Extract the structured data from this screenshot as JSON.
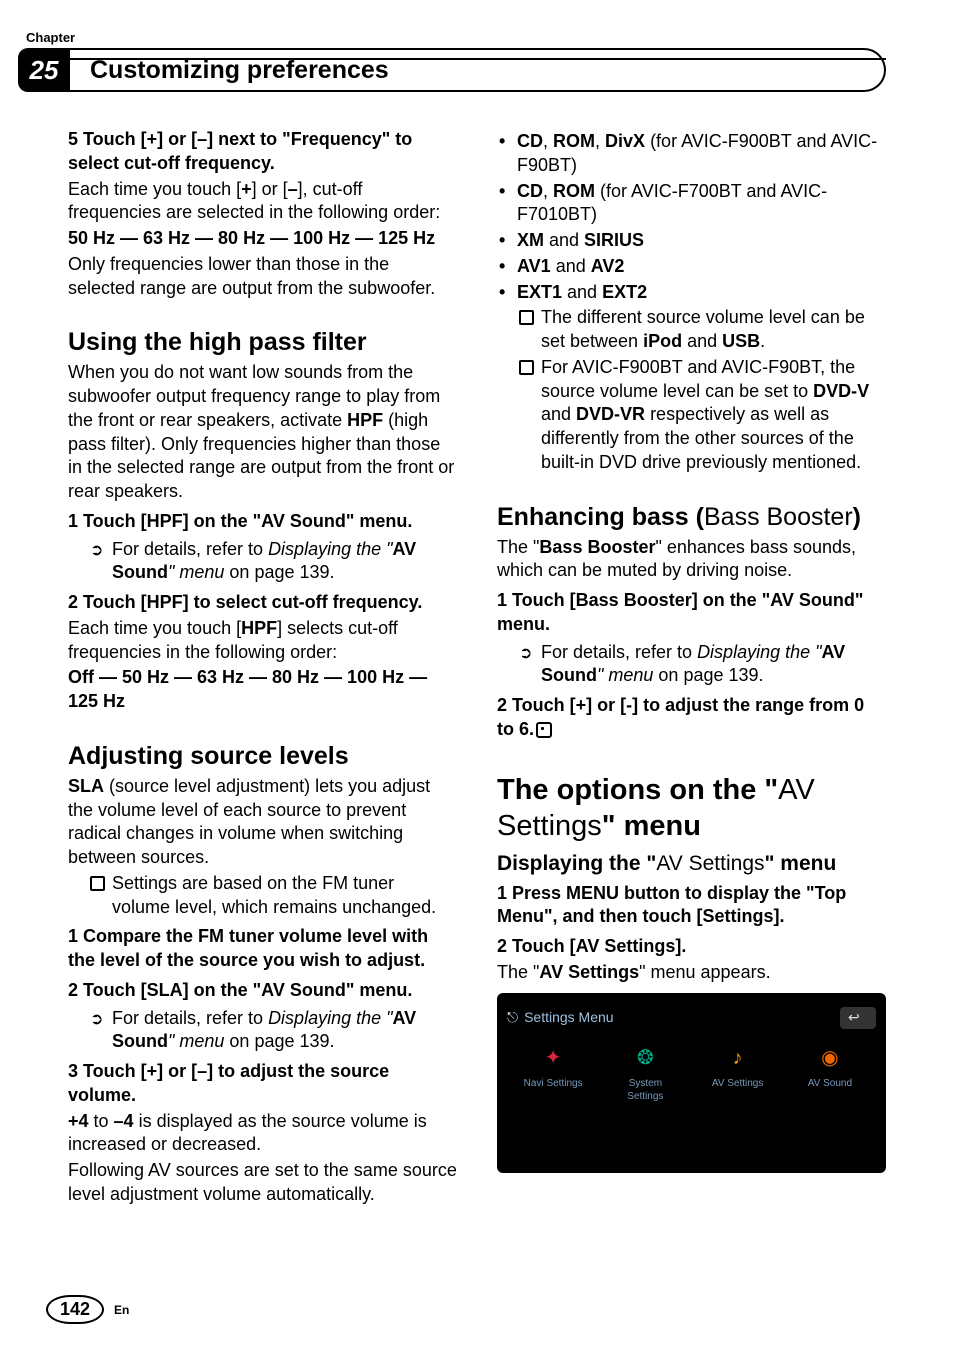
{
  "header": {
    "chapter_label": "Chapter",
    "chapter_num": "25",
    "title": "Customizing preferences"
  },
  "left": {
    "s5_head": "5    Touch [+] or [–] next to \"Frequency\" to select cut-off frequency.",
    "s5_p1_a": "Each time you touch [",
    "s5_p1_b": "+",
    "s5_p1_c": "] or [",
    "s5_p1_d": "–",
    "s5_p1_e": "], cut-off frequencies are selected in the following order:",
    "s5_freq": "50 Hz — 63 Hz — 80 Hz — 100 Hz — 125 Hz",
    "s5_p2": "Only frequencies lower than those in the selected range are output from the subwoofer.",
    "hpf_title": "Using the high pass filter",
    "hpf_p": "When you do not want low sounds from the subwoofer output frequency range to play from the front or rear speakers, activate HPF (high pass filter). Only frequencies higher than those in the selected range are output from the front or rear speakers.",
    "hpf_p_pre": "When you do not want low sounds from the subwoofer output frequency range to play from the front or rear speakers, activate ",
    "hpf_p_bold": "HPF",
    "hpf_p_post": " (high pass filter). Only frequencies higher than those in the selected range are output from the front or rear speakers.",
    "hpf_s1_head": "1    Touch [HPF] on the \"AV Sound\" menu.",
    "ref_prefix": "For details, refer to ",
    "ref_italic": "Displaying the \"",
    "ref_bold": "AV Sound",
    "ref_tail": "\" menu",
    "ref_page": " on page 139.",
    "hpf_s2_head": "2    Touch [HPF] to select cut-off frequency.",
    "hpf_s2_p_a": "Each time you touch [",
    "hpf_s2_p_b": "HPF",
    "hpf_s2_p_c": "] selects cut-off frequencies in the following order:",
    "hpf_s2_freq": "Off — 50 Hz — 63 Hz — 80 Hz — 100 Hz — 125 Hz",
    "sla_title": "Adjusting source levels",
    "sla_p_pre": "SLA",
    "sla_p_rest": " (source level adjustment) lets you adjust the volume level of each source to prevent radical changes in volume when switching between sources.",
    "sla_note": "Settings are based on the FM tuner volume level, which remains unchanged.",
    "sla_s1_head": "1    Compare the FM tuner volume level with the level of the source you wish to adjust.",
    "sla_s2_head": "2    Touch [SLA] on the \"AV Sound\" menu.",
    "sla_s3_head": "3    Touch [+] or [–] to adjust the source volume.",
    "sla_s3_p_a": "+4",
    "sla_s3_p_b": " to ",
    "sla_s3_p_c": "–4",
    "sla_s3_p_d": " is displayed as the source volume is increased or decreased.",
    "sla_s3_p2": "Following AV sources are set to the same source level adjustment volume automatically."
  },
  "right": {
    "b1_a": "CD",
    "b1_b": ", ",
    "b1_c": "ROM",
    "b1_d": ", ",
    "b1_e": "DivX",
    "b1_f": " (for AVIC-F900BT and AVIC-F90BT)",
    "b2_a": "CD",
    "b2_b": ", ",
    "b2_c": "ROM",
    "b2_d": " (for AVIC-F700BT and AVIC-F7010BT)",
    "b3_a": "XM",
    "b3_b": " and ",
    "b3_c": "SIRIUS",
    "b4_a": "AV1",
    "b4_b": " and ",
    "b4_c": "AV2",
    "b5_a": "EXT1",
    "b5_b": " and ",
    "b5_c": "EXT2",
    "n1_a": "The different source volume level can be set between ",
    "n1_b": "iPod",
    "n1_c": " and ",
    "n1_d": "USB",
    "n1_e": ".",
    "n2_a": "For AVIC-F900BT and AVIC-F90BT, the source volume level can be set to ",
    "n2_b": "DVD-V",
    "n2_c": " and ",
    "n2_d": "DVD-VR",
    "n2_e": " respectively as well as differently from the other sources of the built-in DVD drive previously mentioned.",
    "bass_title_a": "Enhancing bass (",
    "bass_title_b": "Bass Booster",
    "bass_title_c": ")",
    "bass_p_a": "The \"",
    "bass_p_b": "Bass Booster",
    "bass_p_c": "\" enhances bass sounds, which can be muted by driving noise.",
    "bass_s1_head": "1    Touch [Bass Booster] on the \"AV Sound\" menu.",
    "bass_s2_head": "2    Touch [+] or [-] to adjust the range from 0 to 6.",
    "opt_title_a": "The options on the \"",
    "opt_title_b": "AV Settings",
    "opt_title_c": "\" menu",
    "opt_sub_a": "Displaying the \"",
    "opt_sub_b": "AV Settings",
    "opt_sub_c": "\" menu",
    "opt_s1_head": "1    Press MENU button to display the \"Top Menu\", and then touch [Settings].",
    "opt_s2_head": "2    Touch [AV Settings].",
    "opt_s2_p_a": "The \"",
    "opt_s2_p_b": "AV Settings",
    "opt_s2_p_c": "\" menu appears.",
    "shot": {
      "title": "Settings Menu",
      "items": [
        "Navi Settings",
        "System Settings",
        "AV Settings",
        "AV Sound"
      ]
    }
  },
  "footer": {
    "page": "142",
    "lang": "En"
  }
}
